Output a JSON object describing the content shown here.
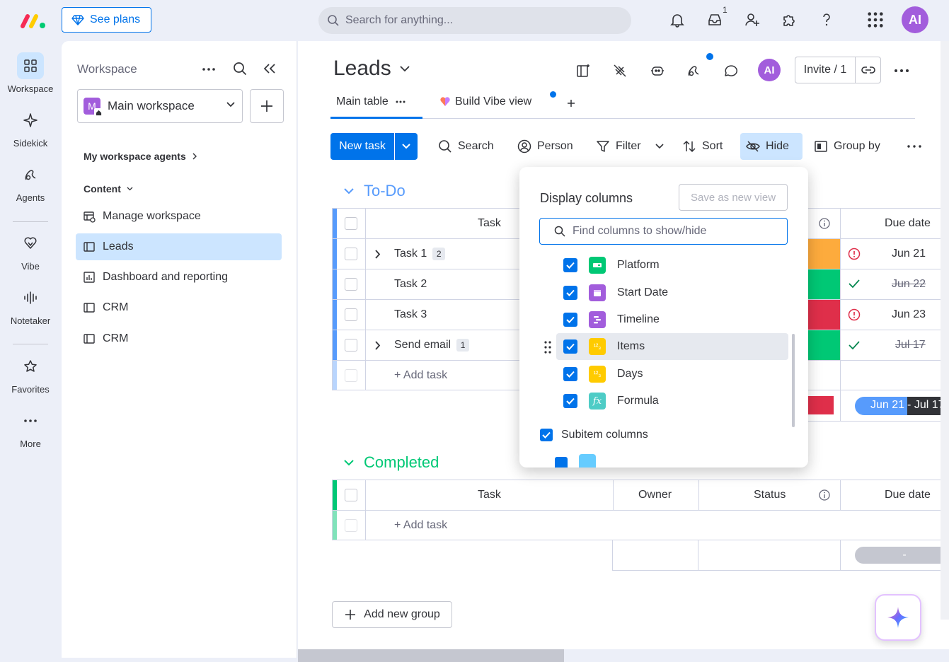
{
  "topbar": {
    "see_plans": "See plans",
    "search_placeholder": "Search for anything...",
    "inbox_count": "1",
    "avatar": "AI"
  },
  "rail": [
    {
      "label": "Workspace",
      "icon": "grid-icon"
    },
    {
      "label": "Sidekick",
      "icon": "sparkle-icon"
    },
    {
      "label": "Agents",
      "icon": "agents-icon"
    },
    {
      "label": "Vibe",
      "icon": "vibe-icon"
    },
    {
      "label": "Notetaker",
      "icon": "waveform-icon"
    },
    {
      "label": "Favorites",
      "icon": "star-icon"
    },
    {
      "label": "More",
      "icon": "more-icon"
    }
  ],
  "sidebar": {
    "header": "Workspace",
    "workspace_letter": "M",
    "workspace_name": "Main workspace",
    "agents_link": "My workspace agents",
    "content_label": "Content",
    "items": [
      {
        "label": "Manage workspace"
      },
      {
        "label": "Leads"
      },
      {
        "label": "Dashboard and reporting"
      },
      {
        "label": "CRM"
      },
      {
        "label": "CRM"
      }
    ]
  },
  "board": {
    "title": "Leads",
    "avatar": "AI",
    "invite_label": "Invite / 1",
    "tabs": [
      {
        "label": "Main table"
      },
      {
        "label": "Build Vibe view"
      }
    ],
    "toolbar": {
      "new_task": "New task",
      "search": "Search",
      "person": "Person",
      "filter": "Filter",
      "sort": "Sort",
      "hide": "Hide",
      "group_by": "Group by"
    },
    "groups": [
      {
        "title": "To-Do",
        "color": "#579bfc",
        "columns": {
          "task": "Task",
          "due": "Due date"
        },
        "rows": [
          {
            "task": "Task 1",
            "subitems": "2",
            "status_color": "#fdab3d",
            "due": "Jun 21",
            "indicator": "alert"
          },
          {
            "task": "Task 2",
            "subitems": "",
            "status_color": "#00c875",
            "due": "Jun 22",
            "indicator": "check"
          },
          {
            "task": "Task 3",
            "subitems": "",
            "status_color": "#df2f4a",
            "due": "Jun 23",
            "indicator": "alert"
          },
          {
            "task": "Send email",
            "subitems": "1",
            "status_color": "#00c875",
            "due": "Jul 17",
            "indicator": "check"
          }
        ],
        "add_task": "+ Add task",
        "summary_timeline_a": "Jun 21",
        "summary_timeline_b": " - Jul 17"
      },
      {
        "title": "Completed",
        "color": "#00c875",
        "columns": {
          "task": "Task",
          "owner": "Owner",
          "status": "Status",
          "due": "Due date"
        },
        "add_task": "+ Add task",
        "summary_dash": "-"
      }
    ],
    "add_group": "Add new group"
  },
  "popup": {
    "title": "Display columns",
    "save_view": "Save as new view",
    "find_placeholder": "Find columns to show/hide",
    "columns": [
      {
        "label": "Platform",
        "color": "#00c875",
        "checked": true
      },
      {
        "label": "Start Date",
        "color": "#a25ddc",
        "checked": true
      },
      {
        "label": "Timeline",
        "color": "#a25ddc",
        "checked": true
      },
      {
        "label": "Items",
        "color": "#ffcb00",
        "checked": true
      },
      {
        "label": "Days",
        "color": "#ffcb00",
        "checked": true
      },
      {
        "label": "Formula",
        "color": "#4eccc6",
        "checked": true
      }
    ],
    "subitem_label": "Subitem columns"
  }
}
